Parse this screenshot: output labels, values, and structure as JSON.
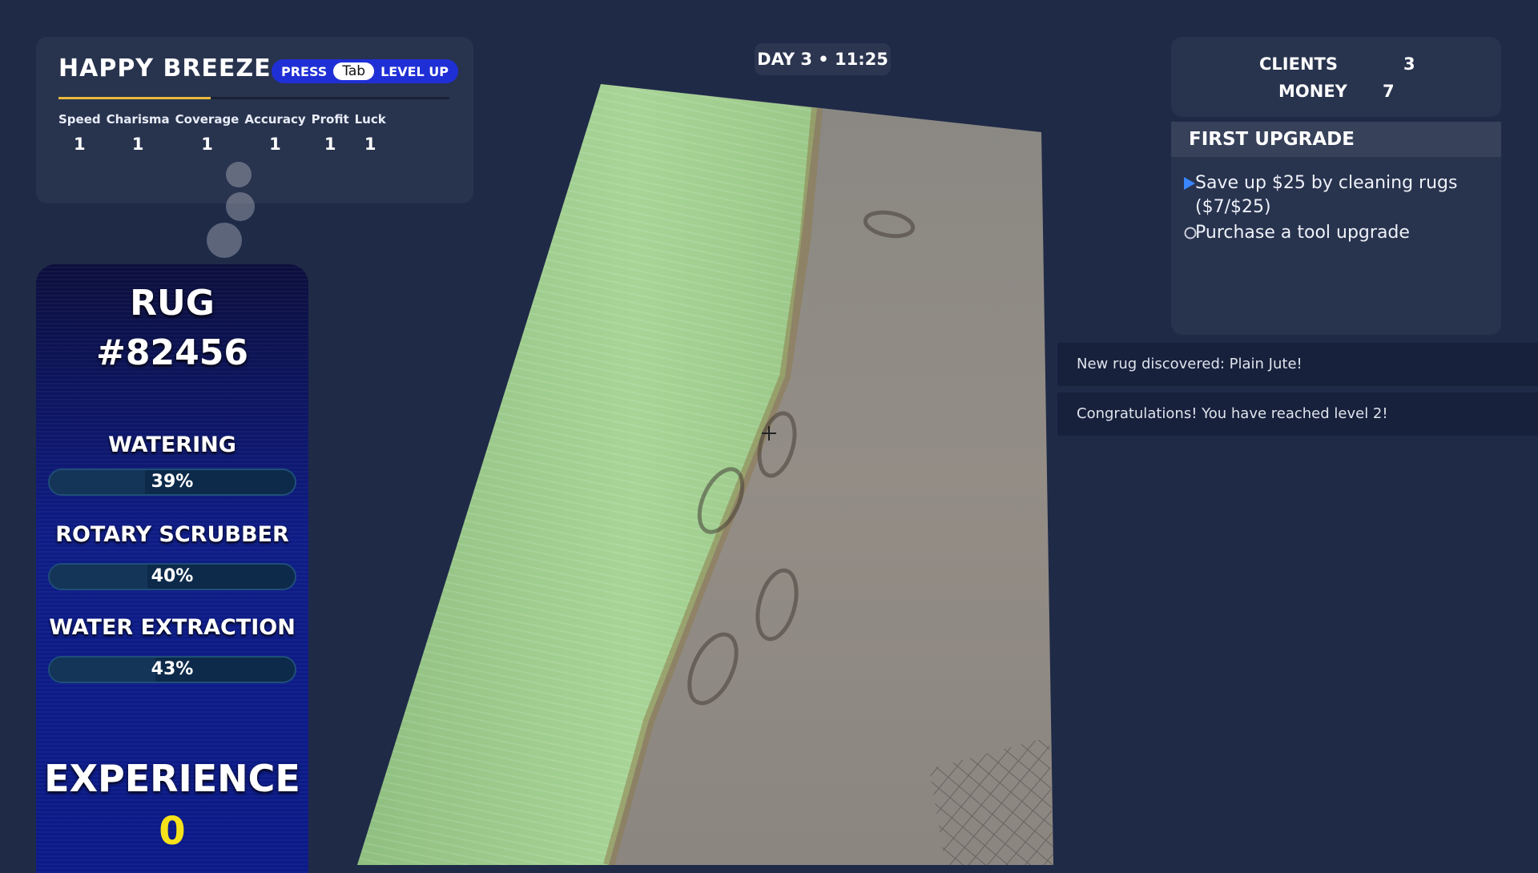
{
  "player": {
    "name": "HAPPY BREEZE",
    "press_label": "PRESS",
    "key_label": "Tab",
    "level_up_label": "LEVEL UP",
    "xp_progress": 0.39,
    "stats": [
      {
        "label": "Speed",
        "value": "1"
      },
      {
        "label": "Charisma",
        "value": "1"
      },
      {
        "label": "Coverage",
        "value": "1"
      },
      {
        "label": "Accuracy",
        "value": "1"
      },
      {
        "label": "Profit",
        "value": "1"
      },
      {
        "label": "Luck",
        "value": "1"
      }
    ]
  },
  "rug": {
    "title_line1": "RUG",
    "title_line2": "#82456",
    "tools": [
      {
        "name": "WATERING",
        "percent_text": "39%",
        "progress": 0.39
      },
      {
        "name": "ROTARY SCRUBBER",
        "percent_text": "40%",
        "progress": 0.4
      },
      {
        "name": "WATER EXTRACTION",
        "percent_text": "43%",
        "progress": 0.43
      }
    ],
    "experience_label": "EXPERIENCE",
    "experience_value": "0"
  },
  "clock": {
    "text": "DAY 3 • 11:25"
  },
  "counters": {
    "clients_label": "CLIENTS",
    "clients_value": "3",
    "money_label": "MONEY",
    "money_value": "7"
  },
  "quest": {
    "title": "FIRST UPGRADE",
    "items": [
      {
        "text": "Save up $25 by cleaning rugs ($7/$25)",
        "status": "active"
      },
      {
        "text": "Purchase a tool upgrade",
        "status": "pending"
      }
    ]
  },
  "notifications": [
    "New rug discovered: Plain Jute!",
    "Congratulations! You have reached level 2!"
  ],
  "colors": {
    "background": "#1f2a47",
    "accent_blue": "#1f2fd6",
    "experience_yellow": "#f6e21a",
    "clean_area_green": "#9ccf86",
    "dirty_area_gray": "#8f8a84"
  }
}
